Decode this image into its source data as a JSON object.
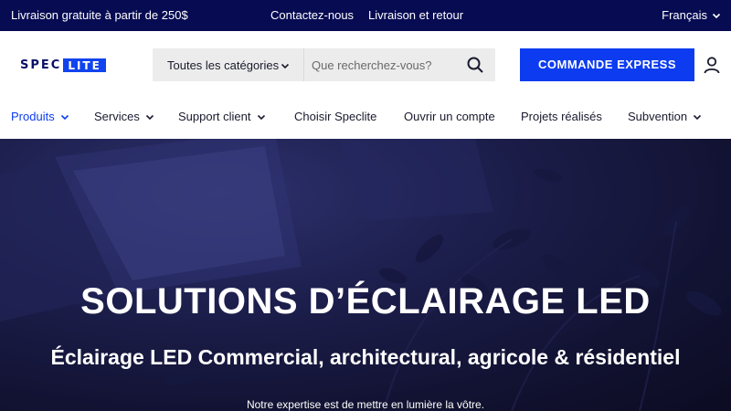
{
  "topbar": {
    "shipping_text": "Livraison gratuite à partir de 250$",
    "contact_link": "Contactez-nous",
    "delivery_link": "Livraison et retour",
    "language": "Français"
  },
  "header": {
    "logo": {
      "part1": "SPEC",
      "part2": "LITE"
    },
    "search": {
      "category": "Toutes les catégories",
      "placeholder": "Que recherchez-vous?"
    },
    "express_button": "COMMANDE EXPRESS"
  },
  "nav": {
    "items": [
      {
        "label": "Produits",
        "has_dropdown": true,
        "active": true
      },
      {
        "label": "Services",
        "has_dropdown": true
      },
      {
        "label": "Support client",
        "has_dropdown": true
      },
      {
        "label": "Choisir Speclite",
        "has_dropdown": false
      },
      {
        "label": "Ouvrir un compte",
        "has_dropdown": false
      },
      {
        "label": "Projets réalisés",
        "has_dropdown": false
      },
      {
        "label": "Subvention",
        "has_dropdown": true
      }
    ]
  },
  "hero": {
    "title": "SOLUTIONS D’ÉCLAIRAGE LED",
    "subtitle": "Éclairage LED Commercial, architectural, agricole & résidentiel",
    "tagline": "Notre expertise est de mettre en lumière la vôtre."
  },
  "colors": {
    "topbar_bg": "#060b52",
    "accent_blue": "#0d3cf0",
    "logo_navy": "#0a1166"
  },
  "icons": [
    "chevron-down-icon",
    "search-icon",
    "user-icon"
  ]
}
